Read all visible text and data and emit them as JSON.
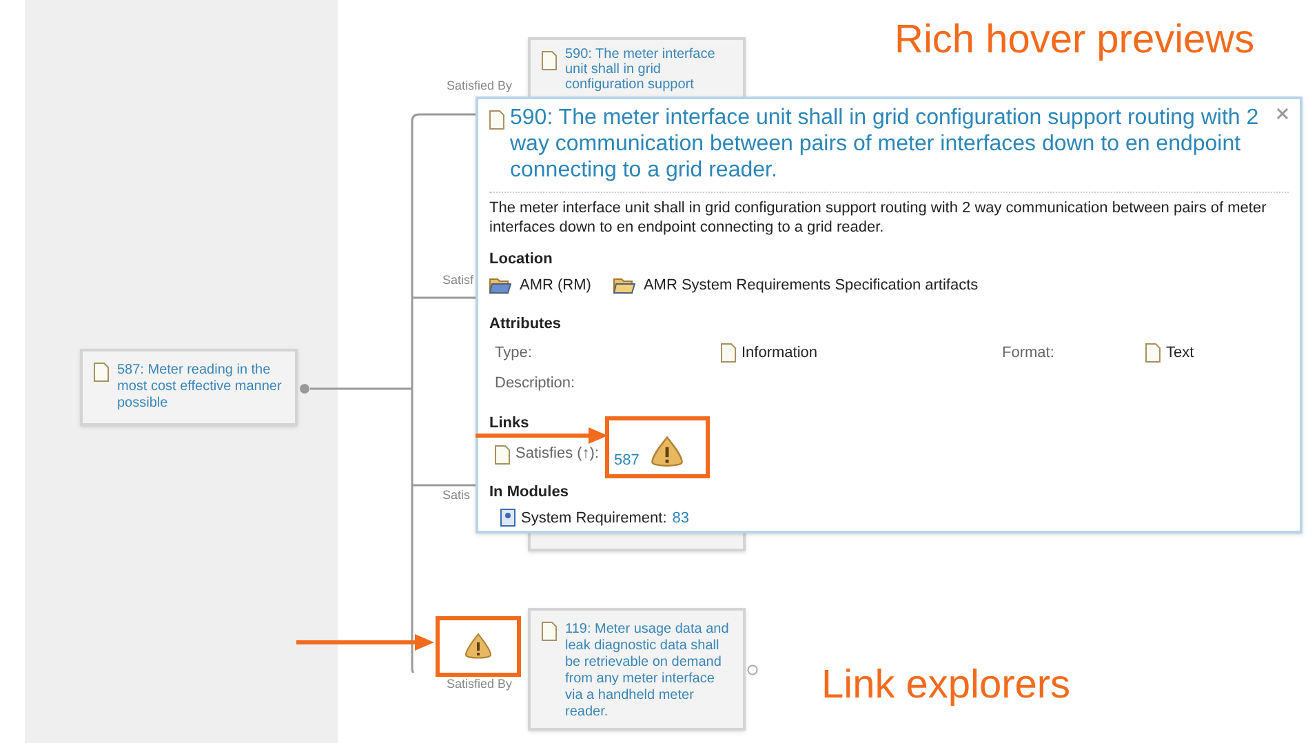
{
  "annotations": [
    {
      "text": "Rich hover previews"
    },
    {
      "text": "Link explorers"
    }
  ],
  "diagram": {
    "root": {
      "text": "587: Meter reading in the most cost effective manner possible"
    },
    "link_labels": [
      "Satisfied By",
      "Satisf",
      "Satis",
      "Satisfied By"
    ],
    "nodes": [
      {
        "text": "590: The meter interface unit shall in grid configuration support"
      },
      {
        "text": "119: Meter usage data and leak diagnostic data shall be retrievable on demand from any meter interface via a handheld meter reader."
      }
    ]
  },
  "hover_preview": {
    "title": "590: The meter interface unit shall in grid configuration support routing with 2 way communication between pairs of meter interfaces down to en endpoint connecting to a grid reader.",
    "description": "The meter interface unit shall in grid configuration support routing with 2 way communication between pairs of meter interfaces down to en endpoint connecting to a grid reader.",
    "location": {
      "heading": "Location",
      "items": [
        "AMR (RM)",
        "AMR System Requirements Specification artifacts"
      ]
    },
    "attributes": {
      "heading": "Attributes",
      "type_label": "Type:",
      "type_value": "Information",
      "format_label": "Format:",
      "format_value": "Text",
      "description_label": "Description:"
    },
    "links": {
      "heading": "Links",
      "label": "Satisfies (↑):",
      "target": "587"
    },
    "modules": {
      "heading": "In Modules",
      "label": "System Requirement:",
      "target": "83"
    }
  }
}
